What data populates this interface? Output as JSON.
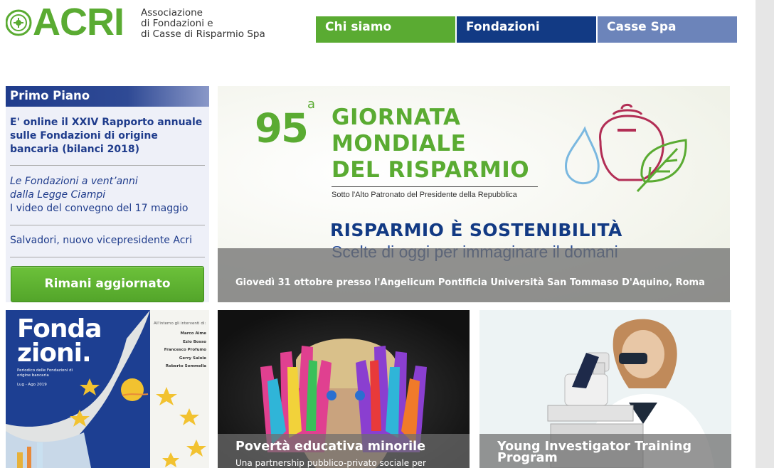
{
  "header": {
    "logo_word": "ACRI",
    "logo_lines": [
      "Associazione",
      "di Fondazioni e",
      "di Casse di Risparmio Spa"
    ],
    "nav": [
      {
        "label": "Chi siamo",
        "color": "#5aab32"
      },
      {
        "label": "Fondazioni",
        "color": "#123a84"
      },
      {
        "label": "Casse Spa",
        "color": "#6c84ba"
      }
    ]
  },
  "primo_piano": {
    "heading": "Primo Piano",
    "item1": "E' online il XXIV Rapporto annuale sulle Fondazioni di origine bancaria (bilanci 2018)",
    "item2_italic_1": "Le Fondazioni a vent’anni",
    "item2_italic_2": "dalla Legge Ciampi",
    "item2_text": "I video del convegno del 17 maggio",
    "item3": "Salvadori, nuovo vicepresidente Acri",
    "button": "Rimani aggiornato"
  },
  "hero": {
    "number": "95",
    "number_sup": "a",
    "title_lines": [
      "GIORNATA",
      "MONDIALE",
      "DEL RISPARMIO"
    ],
    "patronage": "Sotto l'Alto Patronato del Presidente della Repubblica",
    "claim": "RISPARMIO È SOSTENIBILITÀ",
    "subclaim": "Scelte di oggi per immaginare il domani",
    "caption": "Giovedì 31 ottobre presso l'Angelicum Pontificia Università San Tommaso D'Aquino, Roma"
  },
  "cards": {
    "magazine": {
      "title_1": "Fonda",
      "title_2": "zioni.",
      "description": "Periodico delle Fondazioni di origine bancaria",
      "issue": "Lug - Ago 2019",
      "inside_label": "All'interno gli interventi di:",
      "names": [
        "Marco Aime",
        "Ezio Bosso",
        "Francesco Profumo",
        "Gerry Salole",
        "Roberto Sommella"
      ]
    },
    "poverty": {
      "title": "Povertà educativa minorile",
      "text": "Una partnership pubblico-privato sociale per"
    },
    "research": {
      "title": "Young Investigator Training Program"
    }
  },
  "colors": {
    "acri_green": "#5aab32",
    "acri_blue": "#123a84",
    "acri_light_blue": "#6c84ba"
  }
}
